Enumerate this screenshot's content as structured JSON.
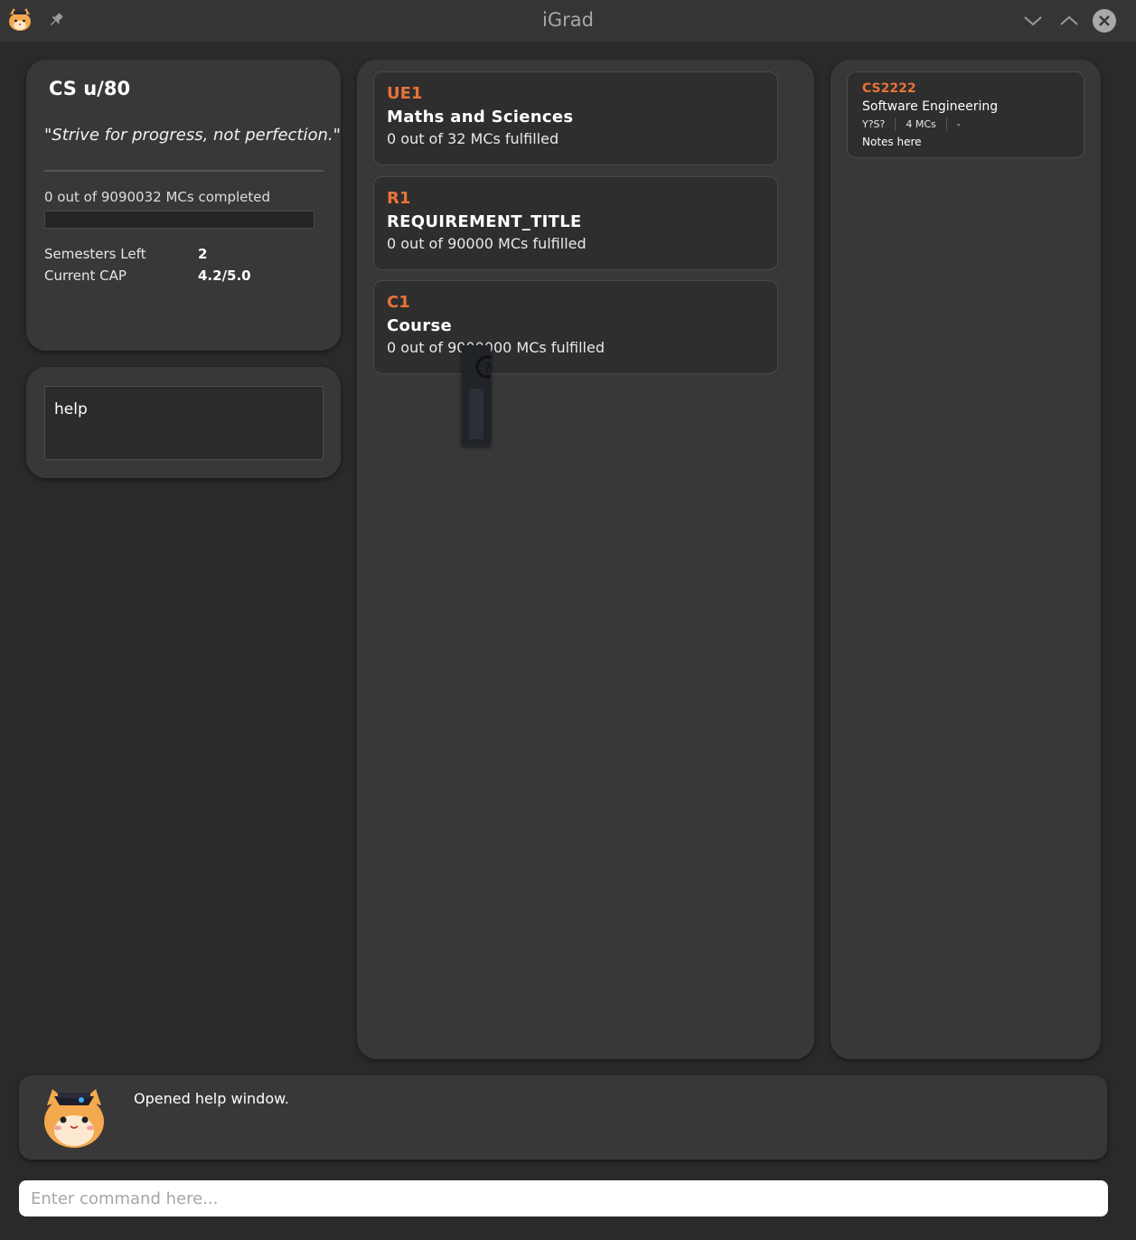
{
  "window": {
    "title": "iGrad"
  },
  "profile": {
    "course_name": "CS u/80",
    "quote": "\"Strive for progress, not perfection.\"",
    "progress_text": "0 out of 9090032 MCs completed",
    "progress_fraction": 0,
    "semesters_left_label": "Semesters Left",
    "semesters_left_value": "2",
    "cap_label": "Current CAP",
    "cap_value": "4.2/5.0"
  },
  "command_box": {
    "text": "help"
  },
  "requirements": [
    {
      "code": "UE1",
      "title": "Maths and Sciences",
      "mcs": "0 out of 32 MCs fulfilled"
    },
    {
      "code": "R1",
      "title": "REQUIREMENT_TITLE",
      "mcs": "0 out of 90000 MCs fulfilled"
    },
    {
      "code": "C1",
      "title": "Course",
      "mcs": "0 out of 9000000 MCs fulfilled"
    }
  ],
  "modules": [
    {
      "code": "CS2222",
      "title": "Software Engineering",
      "semester": "Y?S?",
      "mcs": "4 MCs",
      "grade": "-",
      "notes": "Notes here"
    }
  ],
  "result": {
    "message": "Opened help window."
  },
  "command_input": {
    "placeholder": "Enter command here..."
  },
  "colors": {
    "accent": "#e8733a",
    "panel": "#383838",
    "background": "#2a2a2a"
  },
  "icons": {
    "app": "cat-graduate-icon",
    "pin": "pin-icon",
    "minimize": "chevron-down-icon",
    "maximize": "chevron-up-icon",
    "close": "close-icon"
  }
}
